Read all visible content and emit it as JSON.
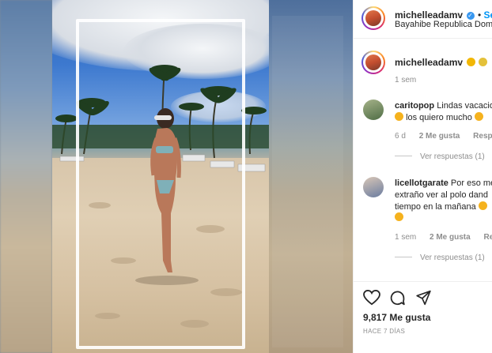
{
  "post": {
    "username": "michelleadamv",
    "follow_label": "Segu",
    "location": "Bayahibe Republica Dominica",
    "caption_time": "1 sem"
  },
  "comments": [
    {
      "username": "caritopop",
      "text_line1": "Lindas vacacio",
      "text_line2": "los quiero mucho",
      "time": "6 d",
      "likes": "2 Me gusta",
      "reply": "Respo",
      "view_replies": "Ver respuestas (1)"
    },
    {
      "username": "licellotgarate",
      "text_line1": "Por eso me",
      "text_line2": "extraño ver al polo dand",
      "text_line3": "tiempo en la mañana",
      "time": "1 sem",
      "likes": "2 Me gusta",
      "reply": "Resp",
      "view_replies": "Ver respuestas (1)"
    }
  ],
  "footer": {
    "likes": "9,817 Me gusta",
    "date": "HACE 7 DÍAS"
  },
  "colors": {
    "link": "#0095f6",
    "verified": "#3897f0",
    "muted": "#8e8e8e"
  },
  "icons": [
    "heart-icon",
    "comment-icon",
    "share-icon",
    "verified-icon"
  ]
}
